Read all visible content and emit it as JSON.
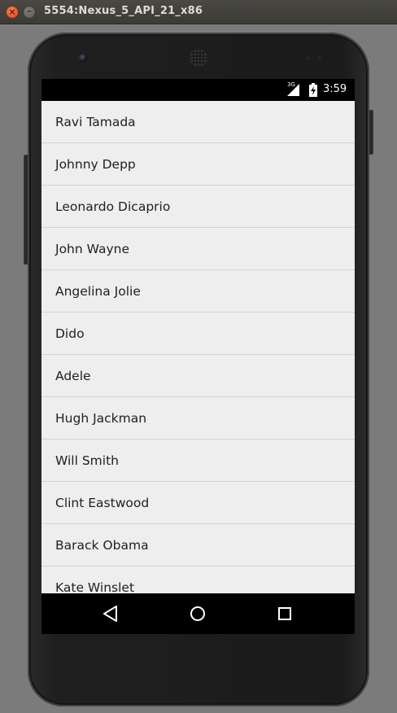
{
  "window": {
    "title": "5554:Nexus_5_API_21_x86",
    "close_glyph": "×",
    "minimize_glyph": "–"
  },
  "status_bar": {
    "network_label": "3G",
    "time": "3:59"
  },
  "list": {
    "items": [
      "Ravi Tamada",
      "Johnny Depp",
      "Leonardo Dicaprio",
      "John Wayne",
      "Angelina Jolie",
      "Dido",
      "Adele",
      "Hugh Jackman",
      "Will Smith",
      "Clint Eastwood",
      "Barack Obama",
      "Kate Winslet"
    ]
  },
  "nav_bar": {
    "buttons": [
      "back-icon",
      "home-icon",
      "recent-apps-icon"
    ]
  },
  "colors": {
    "list_background": "#eeeeee",
    "divider": "#d3d3d3",
    "text": "#212121",
    "status_bar": "#000000"
  }
}
